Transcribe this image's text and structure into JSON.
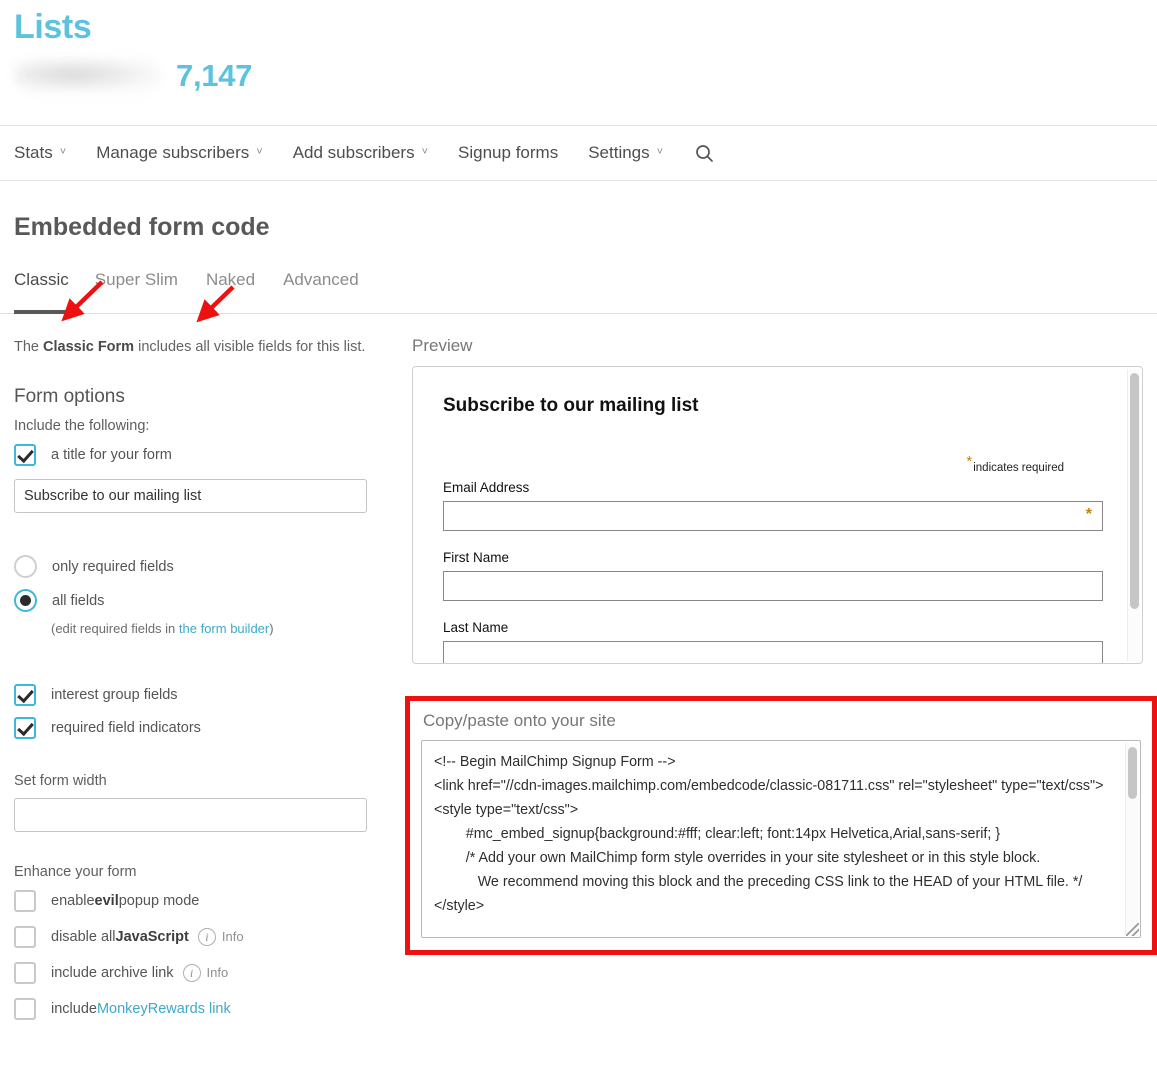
{
  "header": {
    "title": "Lists",
    "list_name": "",
    "subscriber_count": "7,147",
    "accent_color": "#5dc2de"
  },
  "nav": {
    "items": [
      {
        "label": "Stats",
        "caret": "˅",
        "has_caret": true
      },
      {
        "label": "Manage subscribers",
        "caret": "˅",
        "has_caret": true
      },
      {
        "label": "Add subscribers",
        "caret": "˅",
        "has_caret": true
      },
      {
        "label": "Signup forms",
        "caret": "",
        "has_caret": false
      },
      {
        "label": "Settings",
        "caret": "˅",
        "has_caret": true
      }
    ],
    "search_icon": "search-icon"
  },
  "page": {
    "section_title": "Embedded form code"
  },
  "tabs": {
    "items": [
      {
        "label": "Classic",
        "active": true
      },
      {
        "label": "Super Slim",
        "active": false
      },
      {
        "label": "Naked",
        "active": false
      },
      {
        "label": "Advanced",
        "active": false
      }
    ]
  },
  "left": {
    "intro_pre": "The ",
    "intro_bold": "Classic Form",
    "intro_post": " includes all visible fields for this list.",
    "form_options_heading": "Form options",
    "include_label": "Include the following:",
    "title_checkbox": {
      "label": "a title for your form",
      "checked": true
    },
    "title_input_value": "Subscribe to our mailing list",
    "title_input_placeholder": "",
    "radios": [
      {
        "label": "only required fields",
        "selected": false
      },
      {
        "label": "all fields",
        "selected": true
      }
    ],
    "radio_hint_pre": "(edit required fields in ",
    "radio_hint_link": "the form builder",
    "radio_hint_post": ")",
    "field_checkboxes": [
      {
        "label": "interest group fields",
        "checked": true
      },
      {
        "label": "required field indicators",
        "checked": true
      }
    ],
    "set_form_width_label": "Set form width",
    "form_width_value": "",
    "form_width_placeholder": "",
    "enhance_label": "Enhance your form",
    "enhance_options": [
      {
        "pre": "enable ",
        "bold": "evil",
        "post": " popup mode",
        "checked": false,
        "info": false,
        "info_label": "",
        "link": ""
      },
      {
        "pre": "disable all ",
        "bold": "JavaScript",
        "post": "",
        "checked": false,
        "info": true,
        "info_label": "Info",
        "link": ""
      },
      {
        "pre": "include archive link",
        "bold": "",
        "post": "",
        "checked": false,
        "info": true,
        "info_label": "Info",
        "link": ""
      },
      {
        "pre": "include ",
        "bold": "",
        "post": "",
        "checked": false,
        "info": false,
        "info_label": "",
        "link": "MonkeyRewards link"
      }
    ]
  },
  "preview": {
    "label": "Preview",
    "form_title": "Subscribe to our mailing list",
    "required_note": "indicates required",
    "required_star": "*",
    "fields": [
      {
        "label": "Email Address",
        "value": "",
        "required": true
      },
      {
        "label": "First Name",
        "value": "",
        "required": false
      },
      {
        "label": "Last Name",
        "value": "",
        "required": false
      }
    ]
  },
  "copy_paste": {
    "label": "Copy/paste onto your site",
    "highlight_color": "#ee1111",
    "code": "<!-- Begin MailChimp Signup Form -->\n<link href=\"//cdn-images.mailchimp.com/embedcode/classic-081711.css\" rel=\"stylesheet\" type=\"text/css\">\n<style type=\"text/css\">\n\t#mc_embed_signup{background:#fff; clear:left; font:14px Helvetica,Arial,sans-serif; }\n\t/* Add your own MailChimp form style overrides in your site stylesheet or in this style block.\n\t   We recommend moving this block and the preceding CSS link to the HEAD of your HTML file. */\n</style>"
  },
  "annotations": {
    "arrow_color": "#ee1111",
    "arrows": [
      {
        "name": "arrow-to-classic-tab",
        "points_to": "Classic"
      },
      {
        "name": "arrow-to-super-slim-tab",
        "points_to": "Super Slim"
      }
    ]
  }
}
